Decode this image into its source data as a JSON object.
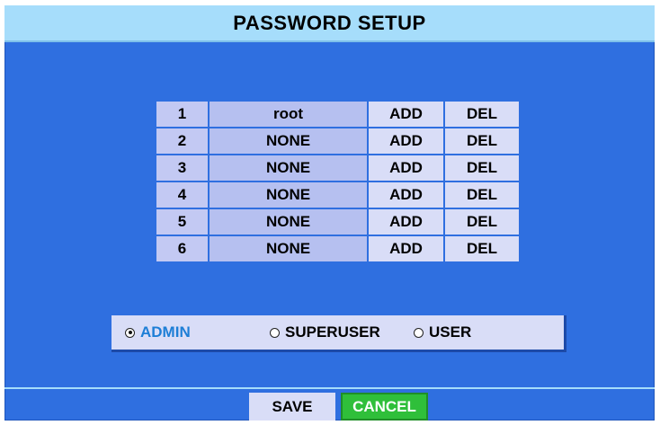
{
  "title": "PASSWORD SETUP",
  "users": [
    {
      "index": "1",
      "name": "root",
      "add": "ADD",
      "del": "DEL"
    },
    {
      "index": "2",
      "name": "NONE",
      "add": "ADD",
      "del": "DEL"
    },
    {
      "index": "3",
      "name": "NONE",
      "add": "ADD",
      "del": "DEL"
    },
    {
      "index": "4",
      "name": "NONE",
      "add": "ADD",
      "del": "DEL"
    },
    {
      "index": "5",
      "name": "NONE",
      "add": "ADD",
      "del": "DEL"
    },
    {
      "index": "6",
      "name": "NONE",
      "add": "ADD",
      "del": "DEL"
    }
  ],
  "levels": {
    "selected": "ADMIN",
    "options": [
      "ADMIN",
      "SUPERUSER",
      "USER"
    ]
  },
  "buttons": {
    "save": "SAVE",
    "cancel": "CANCEL"
  },
  "colors": {
    "panel_bg": "#2f6fe0",
    "title_bg": "#a6ddfb",
    "cell_bg": "#d9ddf7",
    "selected_text": "#1d7ed6",
    "cancel_bg": "#2fbf3a"
  }
}
